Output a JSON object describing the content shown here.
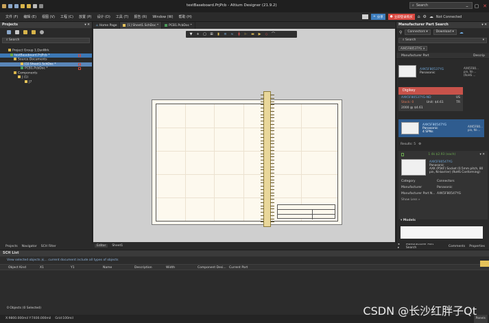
{
  "titlebar": {
    "title": "testBaseboard.PrjPcb - Altium Designer (21.9.2)",
    "search_placeholder": "Search",
    "share_label": "分享",
    "login_label": "立即登录购买",
    "status_label": "Not Connected"
  },
  "menu": [
    "文件 (F)",
    "编辑 (E)",
    "视图 (V)",
    "工程 (C)",
    "放置 (P)",
    "设计 (D)",
    "工具 (T)",
    "报告 (R)",
    "Window (W)",
    "帮助 (H)"
  ],
  "projects": {
    "title": "Projects",
    "search_placeholder": "Search",
    "tree": [
      {
        "label": "Project Group 1.DsnWrk",
        "indent": 0
      },
      {
        "label": "testBaseboard.PrjPcb *",
        "indent": 1,
        "selected": true,
        "modified": true
      },
      {
        "label": "Source Documents",
        "indent": 2
      },
      {
        "label": "[1] Sheet1.SchDoc *",
        "indent": 3,
        "selected": true,
        "modified": true
      },
      {
        "label": "PCB1.PcbDoc *",
        "indent": 3,
        "modified": true
      },
      {
        "label": "Components",
        "indent": 2
      },
      {
        "label": "J (1)",
        "indent": 3
      },
      {
        "label": "J7",
        "indent": 4
      }
    ],
    "bottom_tabs": [
      "Projects",
      "Navigator",
      "SCH Filter"
    ]
  },
  "doc_tabs": [
    "Home Page",
    "[1] Sheet1.SchDoc *",
    "PCB1.PcbDoc *"
  ],
  "editor_tabs": [
    "Editor",
    "Sheet1"
  ],
  "toolbar_icons": [
    "filter-icon",
    "add-icon",
    "select-icon",
    "align-icon",
    "wire-icon",
    "bus-icon",
    "net-icon",
    "power-icon",
    "part-icon",
    "port-icon",
    "text-icon",
    "shape-icon",
    "arc-icon"
  ],
  "mps": {
    "title": "Manufacturer Part Search",
    "connectors_label": "Connectors",
    "download_label": "Download",
    "search_placeholder": "Search",
    "chip": "AXK5F80537YG",
    "col_part": "Manufacturer Part",
    "col_desc": "Descrip",
    "part1": {
      "name": "AXK5F80537YG",
      "maker": "Panasonic",
      "desc": "AXK5F80... pin, Ni-... (RoHS ..."
    },
    "distributor": {
      "name": "Digikey",
      "part": "AXK5F80537YG-ND",
      "region": "US",
      "stock": "Stock: 0",
      "unit": "Unit: $4.61",
      "tr": "TR",
      "qty": "2000 @ $4.61"
    },
    "part2": {
      "name": "AXK5F80547YG",
      "maker": "Panasonic",
      "sources": "4 SPNs",
      "desc": "AXK5F80... pin, Ni-..."
    },
    "results": "Results: 5",
    "detail": {
      "price": "1 4k $2.93 (each)",
      "name": "AXK5F80547YG",
      "maker": "Panasonic",
      "desc": "AXK (P5KF) Socket (0.5mm pitch, 80 pin, Ni-barrier) (RoHS Conforming)",
      "category_k": "Category",
      "category_v": "Connectors",
      "manufacturer_k": "Manufacturer",
      "manufacturer_v": "Panasonic",
      "mpn_k": "Manufacturer Part N...",
      "mpn_v": "AXK5F80547YG",
      "show_less": "Show Less »",
      "models": "Models"
    },
    "bottom_tabs": [
      "Manufacturer Part Search",
      "Comments",
      "Properties"
    ]
  },
  "schlist": {
    "title": "SCH List",
    "filter_text": "View selected objects 从... current document include all types of objects",
    "columns": [
      "Object Kind",
      "X1",
      "Y1",
      "Name",
      "Description",
      "Width",
      "Component Desi...",
      "Current Part"
    ],
    "count": "0 Objects (0 Selected)"
  },
  "statusbar": {
    "coords": "X:9800.000mil Y:7400.000mil",
    "grid": "Grid:100mil",
    "panels_label": "Panels"
  },
  "watermark": "CSDN @长沙红胖子Qt"
}
